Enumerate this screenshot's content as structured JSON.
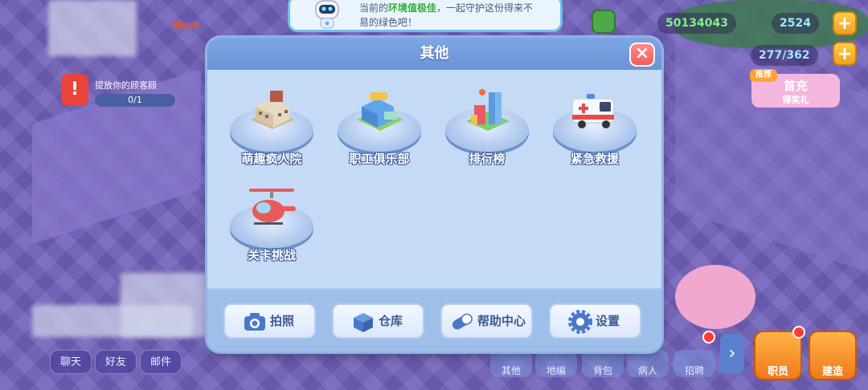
{
  "notice": {
    "prefix": "当前的",
    "highlight": "环境值极佳",
    "suffix": "，一起守护这份得来不",
    "line2": "易的绿色吧！"
  },
  "hud": {
    "coins": "50134043",
    "gems": "2524",
    "capacity": "277/362",
    "building_label": "劳动中",
    "upgrade_tip": "提放你的顾客顾",
    "progress": "0/1",
    "promo_title": "首充",
    "promo_sub": "得奖礼",
    "promo_badge": "推荐"
  },
  "modal": {
    "title": "其他",
    "close": "×",
    "items": [
      {
        "label": "萌趣疯人院",
        "icon": "asylum-building-icon"
      },
      {
        "label": "职工俱乐部",
        "icon": "staff-club-icon"
      },
      {
        "label": "排行榜",
        "icon": "ranking-tower-icon"
      },
      {
        "label": "紧急救援",
        "icon": "ambulance-icon"
      },
      {
        "label": "关卡挑战",
        "icon": "helicopter-icon"
      }
    ],
    "footer": [
      {
        "label": "拍照",
        "icon": "camera-icon"
      },
      {
        "label": "仓库",
        "icon": "warehouse-box-icon"
      },
      {
        "label": "帮助中心",
        "icon": "pill-help-icon"
      },
      {
        "label": "设置",
        "icon": "gear-icon"
      }
    ]
  },
  "bottom_left": [
    "聊天",
    "好友",
    "邮件"
  ],
  "bottom_right": [
    "其他",
    "地编",
    "背包",
    "病人",
    "招聘"
  ],
  "big_buttons": [
    "职员",
    "建造"
  ],
  "colors": {
    "modal_bg": "#bcd6f4",
    "header": "#7fa6e3",
    "close": "#f25c5c",
    "coin_text": "#7ff08a",
    "accent_orange": "#f07a1a"
  }
}
